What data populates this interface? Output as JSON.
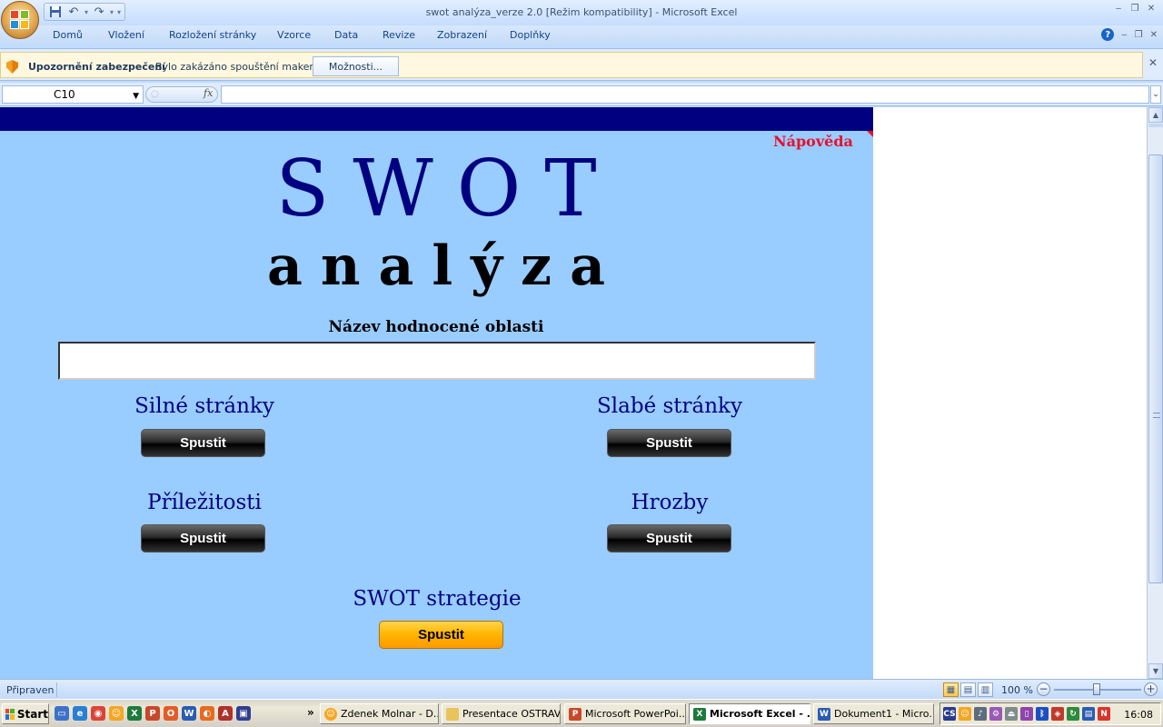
{
  "window": {
    "title": "swot analýza_verze 2.0  [Režim kompatibility]  -  Microsoft Excel"
  },
  "ribbon": {
    "tabs": [
      "Domů",
      "Vložení",
      "Rozložení stránky",
      "Vzorce",
      "Data",
      "Revize",
      "Zobrazení",
      "Doplňky"
    ]
  },
  "security_bar": {
    "title": "Upozornění zabezpečení",
    "message": "Bylo zakázáno spouštění maker.",
    "options_button": "Možnosti..."
  },
  "formula_bar": {
    "name_box": "C10",
    "fx_label": "fx",
    "formula": ""
  },
  "sheet": {
    "help_link": "Nápověda",
    "title_main": "SWOT",
    "title_sub": "analýza",
    "area_label": "Název hodnocené oblasti",
    "area_value": "",
    "sections": {
      "strengths": {
        "heading": "Silné stránky",
        "button": "Spustit"
      },
      "weaknesses": {
        "heading": "Slabé stránky",
        "button": "Spustit"
      },
      "opportunities": {
        "heading": "Příležitosti",
        "button": "Spustit"
      },
      "threats": {
        "heading": "Hrozby",
        "button": "Spustit"
      },
      "strategy": {
        "heading": "SWOT strategie",
        "button": "Spustit"
      }
    },
    "colors": {
      "background": "#99ccff",
      "header_band": "#000080",
      "heading_text": "#000080",
      "help_link": "#e8112d",
      "strategy_button": "#ffb400"
    }
  },
  "status_bar": {
    "status": "Připraven",
    "zoom": "100 %"
  },
  "taskbar": {
    "start_label": "Start",
    "tasks": [
      {
        "label": "Zdenek Molnar - D...",
        "icon": "messenger-icon"
      },
      {
        "label": "Presentace OSTRAVA",
        "icon": "folder-icon"
      },
      {
        "label": "Microsoft PowerPoi...",
        "icon": "powerpoint-icon"
      },
      {
        "label": "Microsoft Excel - ...",
        "icon": "excel-icon"
      },
      {
        "label": "Dokument1 - Micro...",
        "icon": "word-icon"
      }
    ],
    "clock": "16:08"
  }
}
